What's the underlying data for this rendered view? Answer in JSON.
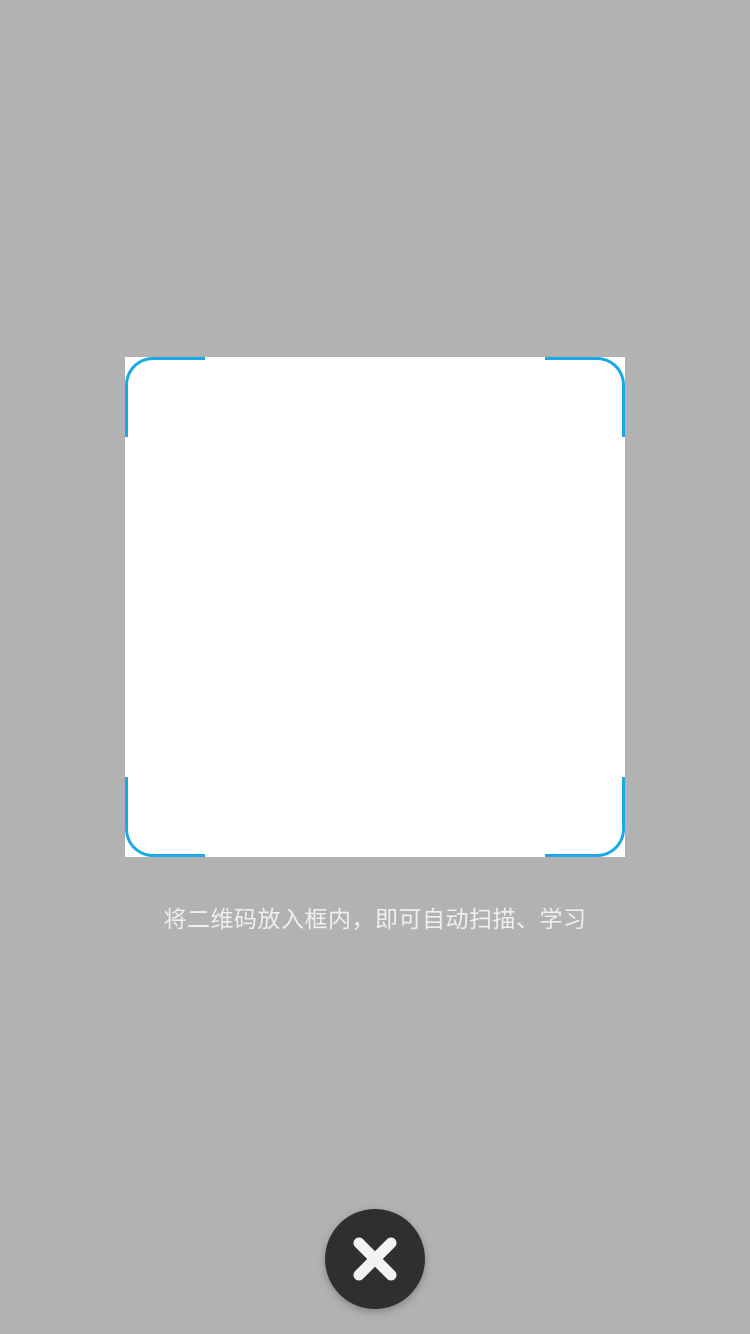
{
  "scanner": {
    "hint": "将二维码放入框内，即可自动扫描、学习"
  },
  "colors": {
    "background": "#b2b2b2",
    "frame_corner": "#1aa9e6",
    "close_button": "#2f2f30"
  },
  "icons": {
    "close": "close-icon"
  }
}
